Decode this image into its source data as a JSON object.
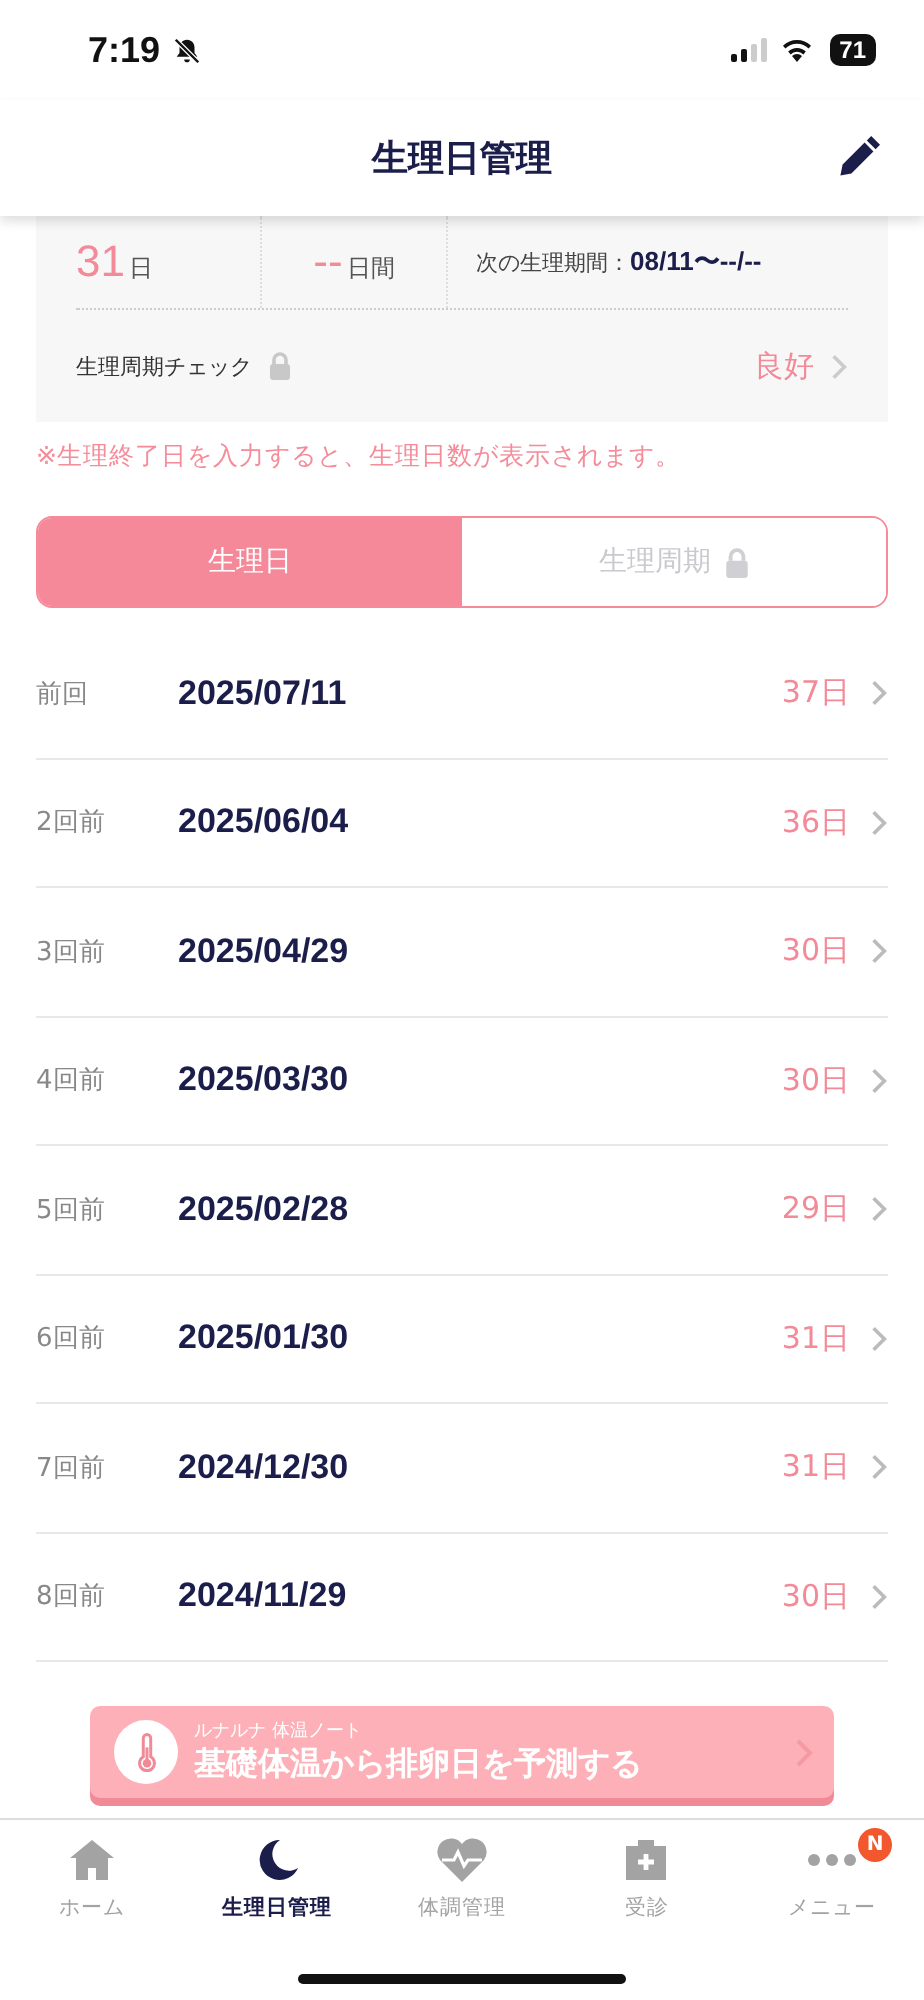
{
  "status_bar": {
    "time": "7:19",
    "battery": "71"
  },
  "header": {
    "title": "生理日管理"
  },
  "summary": {
    "stats": [
      {
        "value": "31",
        "unit": "日"
      },
      {
        "value": "--",
        "unit": "日間"
      }
    ],
    "next_label": "次の生理期間：",
    "next_value": "08/11〜--/--",
    "check_label": "生理周期チェック",
    "check_value": "良好"
  },
  "note": "※生理終了日を入力すると、生理日数が表示されます。",
  "tabs": [
    {
      "label": "生理日",
      "selected": true,
      "locked": false
    },
    {
      "label": "生理周期",
      "selected": false,
      "locked": true
    }
  ],
  "records": [
    {
      "label": "前回",
      "date": "2025/07/11",
      "days": "37日"
    },
    {
      "label": "2回前",
      "date": "2025/06/04",
      "days": "36日"
    },
    {
      "label": "3回前",
      "date": "2025/04/29",
      "days": "30日"
    },
    {
      "label": "4回前",
      "date": "2025/03/30",
      "days": "30日"
    },
    {
      "label": "5回前",
      "date": "2025/02/28",
      "days": "29日"
    },
    {
      "label": "6回前",
      "date": "2025/01/30",
      "days": "31日"
    },
    {
      "label": "7回前",
      "date": "2024/12/30",
      "days": "31日"
    },
    {
      "label": "8回前",
      "date": "2024/11/29",
      "days": "30日"
    }
  ],
  "banner": {
    "subtitle": "ルナルナ 体温ノート",
    "title": "基礎体温から排卵日を予測する"
  },
  "tab_bar": [
    {
      "label": "ホーム",
      "kind": "home",
      "selected": false
    },
    {
      "label": "生理日管理",
      "kind": "moon",
      "selected": true
    },
    {
      "label": "体調管理",
      "kind": "heart",
      "selected": false
    },
    {
      "label": "受診",
      "kind": "clinic",
      "selected": false
    },
    {
      "label": "メニュー",
      "kind": "menu",
      "selected": false,
      "badge": "N"
    }
  ]
}
